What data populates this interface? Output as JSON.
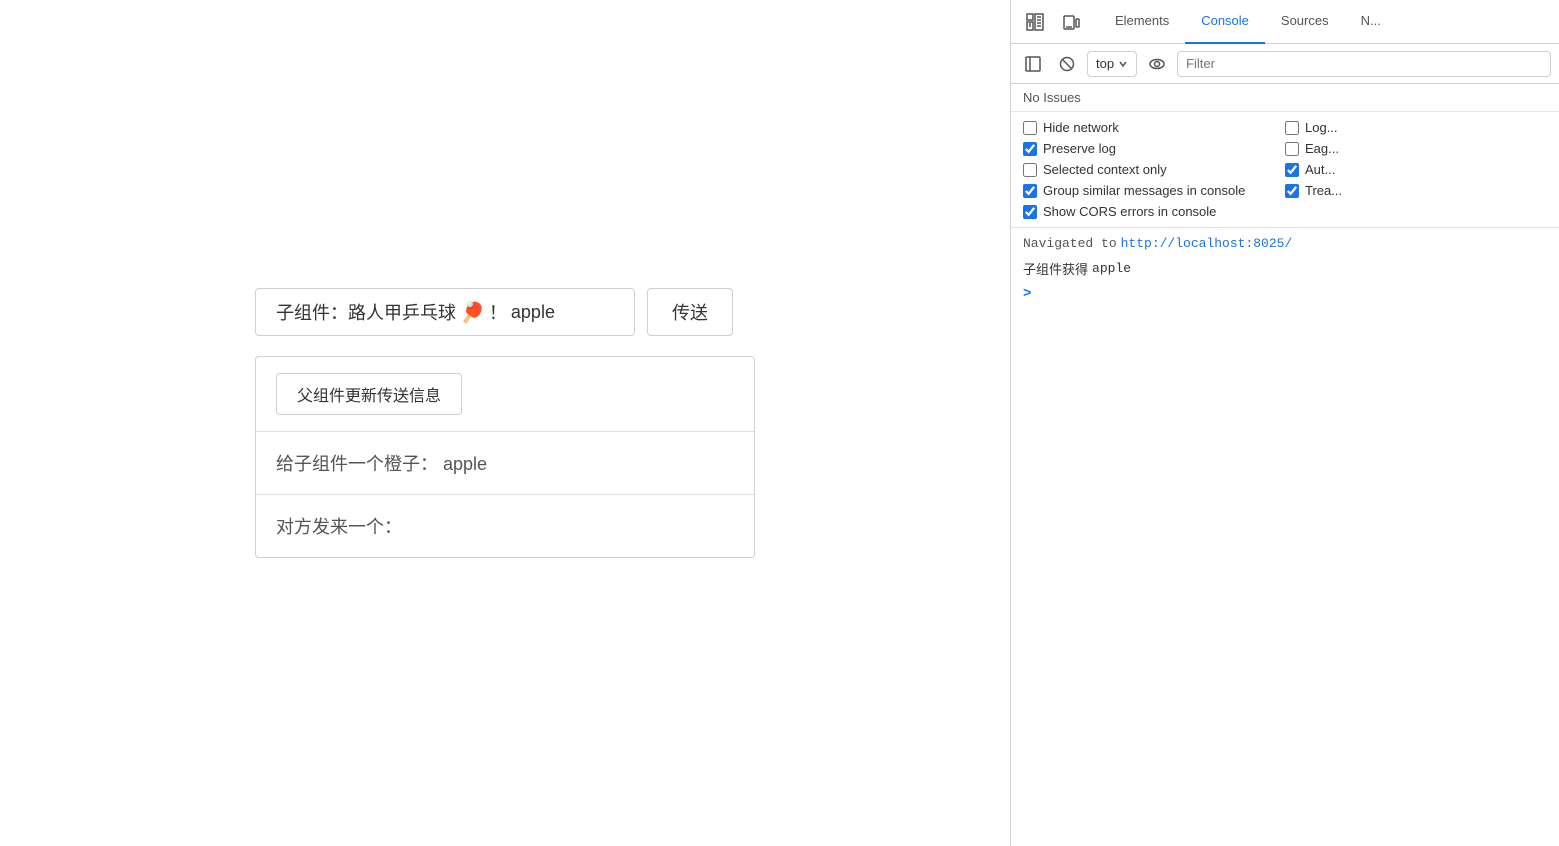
{
  "mainPanel": {
    "childComponent": {
      "label": "子组件：路人甲乒乓球",
      "emoji": "🏓",
      "value": "apple",
      "sendButton": "传送"
    },
    "parentComponent": {
      "updateButton": "父组件更新传送信息",
      "orangeLabel": "给子组件一个橙子：",
      "orangeValue": "apple",
      "fromPeerLabel": "对方发来一个："
    }
  },
  "devtools": {
    "tabs": [
      {
        "label": "Elements",
        "active": false
      },
      {
        "label": "Console",
        "active": true
      },
      {
        "label": "Sources",
        "active": false
      },
      {
        "label": "N...",
        "active": false
      }
    ],
    "toolbar": {
      "topDropdown": "top",
      "filterPlaceholder": "Filter"
    },
    "issuesBar": "No Issues",
    "options": [
      {
        "id": "hide-network",
        "label": "Hide network",
        "checked": false
      },
      {
        "id": "log-xhr",
        "label": "Log...",
        "checked": false
      },
      {
        "id": "preserve-log",
        "label": "Preserve log",
        "checked": true
      },
      {
        "id": "eager",
        "label": "Eag...",
        "checked": false
      },
      {
        "id": "selected-context",
        "label": "Selected context only",
        "checked": false
      },
      {
        "id": "auto",
        "label": "Aut...",
        "checked": true
      },
      {
        "id": "group-similar",
        "label": "Group similar messages in console",
        "checked": true
      },
      {
        "id": "treat",
        "label": "Trea...",
        "checked": true
      },
      {
        "id": "show-cors",
        "label": "Show CORS errors in console",
        "checked": true
      }
    ],
    "console": {
      "navigatedText": "Navigated to",
      "navigatedUrl": "http://localhost:8025/",
      "logLine1Prefix": "子组件获得",
      "logLine1Value": "apple",
      "promptSymbol": ">"
    }
  }
}
